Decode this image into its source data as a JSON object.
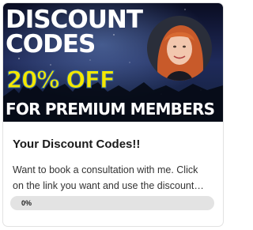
{
  "course_card": {
    "banner": {
      "line1": "DISCOUNT",
      "line2": "CODES",
      "offer": "20% OFF",
      "subline": "FOR PREMIUM MEMBERS"
    },
    "title": "Your Discount Codes!!",
    "description_line1": "Want to book a consultation with me. Click",
    "description_line2": "on the link you want and use the discount…",
    "progress": {
      "percent": 0,
      "label": "0%"
    }
  },
  "colors": {
    "banner_text": "#ffffff",
    "offer_text": "#f4e800",
    "progress_track": "#e3e3e3"
  }
}
